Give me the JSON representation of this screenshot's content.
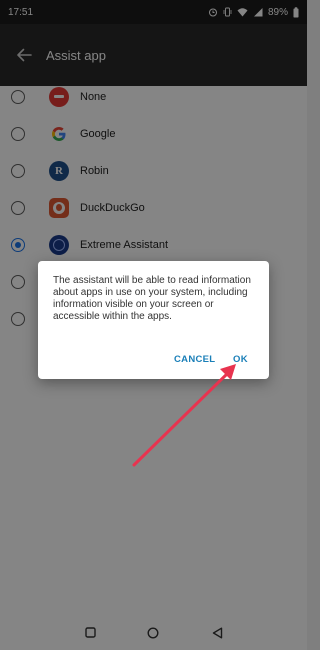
{
  "statusbar": {
    "time": "17:51",
    "battery": "89%"
  },
  "appbar": {
    "title": "Assist app"
  },
  "options": [
    {
      "label": "None",
      "icon": "none-app-icon",
      "color": "#e53935",
      "checked": false
    },
    {
      "label": "Google",
      "icon": "google-icon",
      "color": "#4285f4",
      "checked": false
    },
    {
      "label": "Robin",
      "icon": "robin-icon",
      "color": "#1e4f8a",
      "checked": false
    },
    {
      "label": "DuckDuckGo",
      "icon": "duckduckgo-icon",
      "color": "#de5833",
      "checked": false
    },
    {
      "label": "Extreme Assistant",
      "icon": "extreme-assistant-icon",
      "color": "#1a3a8a",
      "checked": true
    }
  ],
  "dialog": {
    "message": "The assistant will be able to read information about apps in use on your system, including information visible on your screen or accessible within the apps.",
    "cancel": "CANCEL",
    "ok": "OK"
  },
  "colors": {
    "accent": "#1a73e8",
    "dialog_button": "#1a7fb8",
    "annotation_arrow": "#e8334f"
  }
}
